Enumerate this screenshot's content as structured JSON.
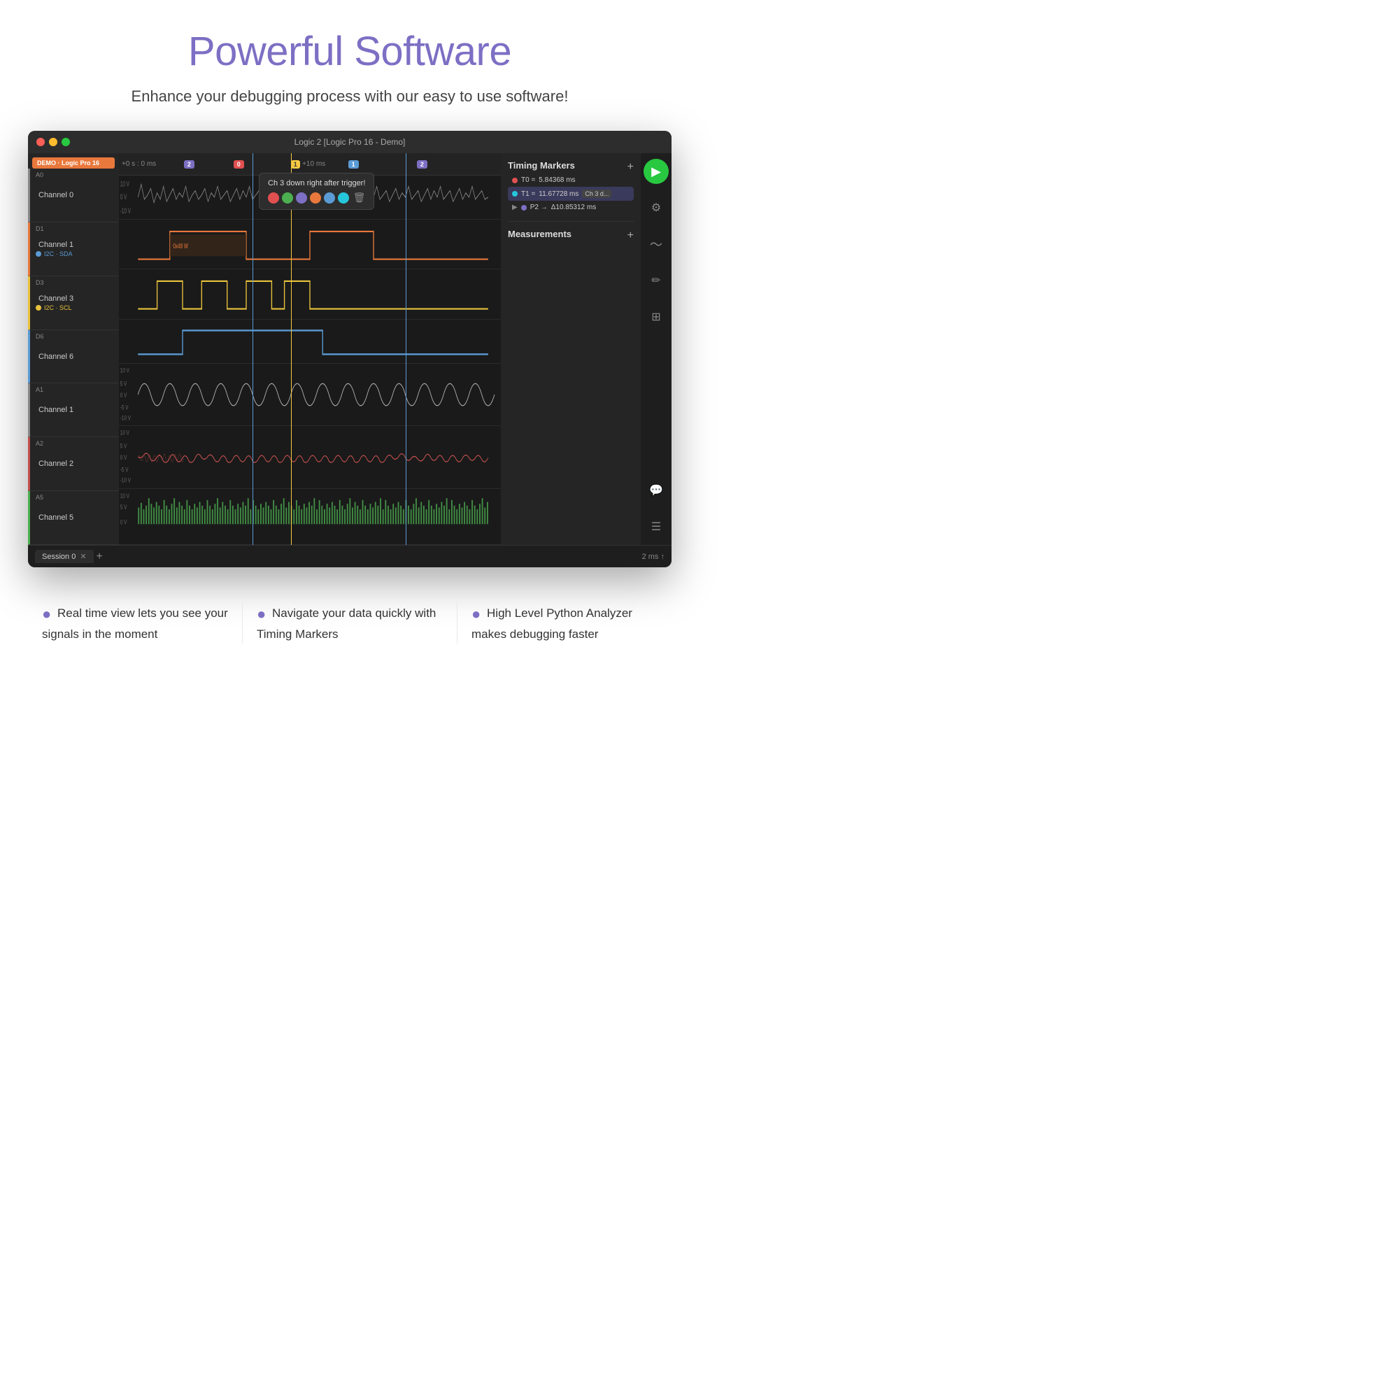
{
  "header": {
    "title": "Powerful Software",
    "subtitle": "Enhance your debugging process with our easy to use software!"
  },
  "window": {
    "title": "Logic 2 [Logic Pro 16 - Demo]",
    "demo_badge": "DEMO · Logic Pro 16",
    "time_label": "+0 s : 0 ms",
    "time_plus": "+10 ms",
    "tab_name": "Session 0",
    "zoom_level": "2 ms ↑"
  },
  "channels": [
    {
      "id": "A0",
      "name": "Channel 0",
      "class": "ch0",
      "protocol": null
    },
    {
      "id": "D1",
      "name": "Channel 1",
      "class": "ch1",
      "protocol": "I2C · SDA"
    },
    {
      "id": "D3",
      "name": "Channel 3",
      "class": "ch3",
      "protocol": "I2C · SCL"
    },
    {
      "id": "D6",
      "name": "Channel 6",
      "class": "ch6",
      "protocol": null
    },
    {
      "id": "A1",
      "name": "Channel 1",
      "class": "cha1",
      "protocol": null
    },
    {
      "id": "A2",
      "name": "Channel 2",
      "class": "cha2",
      "protocol": null
    },
    {
      "id": "A5",
      "name": "Channel 5",
      "class": "cha5",
      "protocol": null
    }
  ],
  "timing_markers": {
    "title": "Timing Markers",
    "entries": [
      {
        "id": "T0",
        "value": "5.84368 ms",
        "color": "red",
        "selected": false
      },
      {
        "id": "T1",
        "value": "11.67728 ms",
        "color": "teal",
        "selected": true,
        "tag": "Ch 3 d..."
      },
      {
        "id": "P2",
        "value": "Δ10.85312 ms",
        "color": "purple",
        "selected": false,
        "arrow": true
      }
    ]
  },
  "measurements": {
    "title": "Measurements"
  },
  "tooltip": {
    "text": "Ch 3 down right after trigger!"
  },
  "features": [
    {
      "bullet": "●",
      "text": "Real time view lets you see your signals in the moment"
    },
    {
      "bullet": "●",
      "text": "Navigate your data quickly with Timing Markers"
    },
    {
      "bullet": "●",
      "text": "High Level Python Analyzer makes debugging faster"
    }
  ],
  "icons": {
    "play": "▶",
    "settings": "⚙",
    "wave": "〜",
    "pencil": "✏",
    "grid": "⊞",
    "chat": "💬",
    "menu": "☰",
    "add": "+"
  }
}
